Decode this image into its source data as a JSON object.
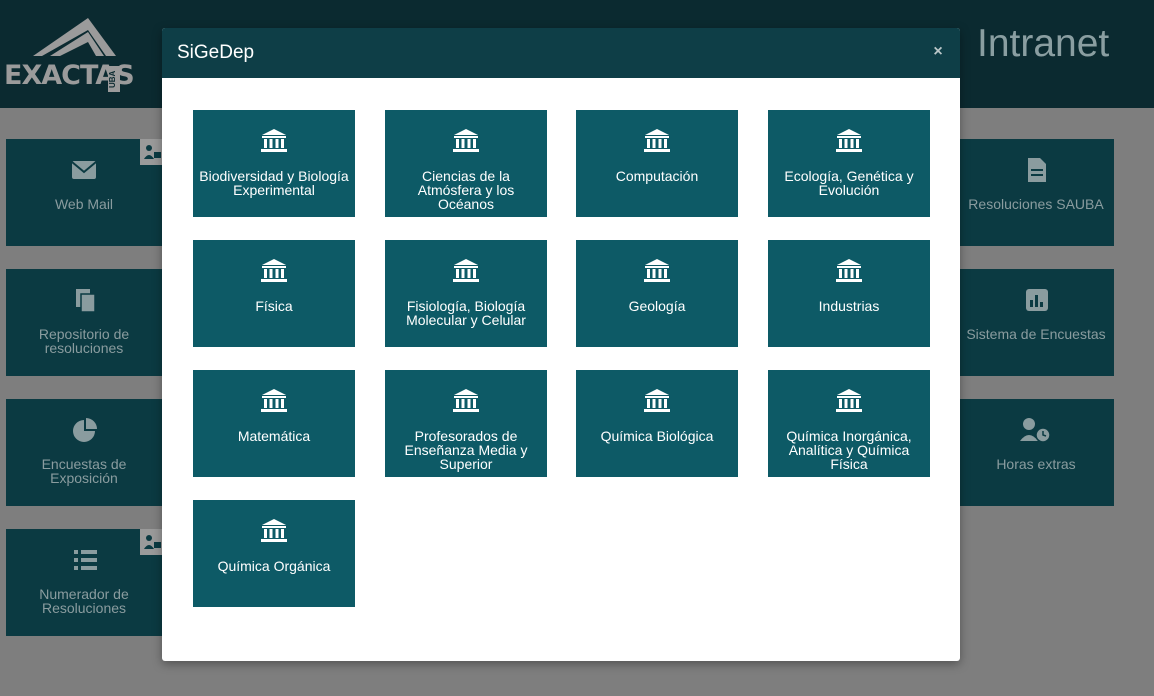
{
  "header": {
    "logo_text": "EXACTAS",
    "logo_sub": "UBA",
    "app_title": "Intranet"
  },
  "background_tiles": [
    {
      "label": "Web Mail",
      "icon": "envelope-icon"
    },
    {
      "label": "Repositorio de resoluciones",
      "icon": "files-icon"
    },
    {
      "label": "Encuestas de Exposición",
      "icon": "pie-chart-icon"
    },
    {
      "label": "Numerador de Resoluciones",
      "icon": "numbered-list-icon"
    },
    {
      "label": "Resoluciones SAUBA",
      "icon": "document-icon"
    },
    {
      "label": "Sistema de Encuestas",
      "icon": "bar-chart-icon"
    },
    {
      "label": "Horas extras",
      "icon": "user-clock-icon"
    }
  ],
  "modal": {
    "title": "SiGeDep",
    "close_label": "×",
    "departments": [
      {
        "label": "Biodiversidad y Biología Experimental"
      },
      {
        "label": "Ciencias de la Atmósfera y los Océanos"
      },
      {
        "label": "Computación"
      },
      {
        "label": "Ecología, Genética y Evolución"
      },
      {
        "label": "Física"
      },
      {
        "label": "Fisiología, Biología Molecular y Celular"
      },
      {
        "label": "Geología"
      },
      {
        "label": "Industrias"
      },
      {
        "label": "Matemática"
      },
      {
        "label": "Profesorados de Enseñanza Media y Superior"
      },
      {
        "label": "Química Biológica"
      },
      {
        "label": "Química Inorgánica, Analítica y Química Física"
      },
      {
        "label": "Química Orgánica"
      }
    ]
  },
  "colors": {
    "topbar": "#0b2a30",
    "tile": "#0b3a42",
    "modal_header": "#0e3e47",
    "department_tile": "#0d5a66"
  }
}
